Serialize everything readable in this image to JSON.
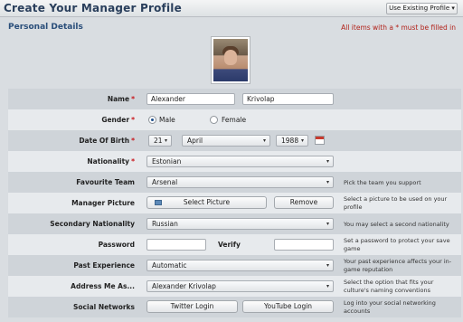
{
  "header": {
    "title": "Create Your Manager Profile",
    "use_existing_label": "Use Existing Profile ▾"
  },
  "section": {
    "title": "Personal Details",
    "required_note": "All items with a * must be filled in"
  },
  "form": {
    "name": {
      "label": "Name",
      "first": "Alexander",
      "last": "Krivolap"
    },
    "gender": {
      "label": "Gender",
      "options": [
        "Male",
        "Female"
      ],
      "selected": "Male"
    },
    "dob": {
      "label": "Date Of Birth",
      "day": "21",
      "month": "April",
      "year": "1988"
    },
    "nationality": {
      "label": "Nationality",
      "value": "Estonian"
    },
    "favourite_team": {
      "label": "Favourite Team",
      "value": "Arsenal",
      "desc": "Pick the team you support"
    },
    "manager_picture": {
      "label": "Manager Picture",
      "select_label": "Select Picture",
      "remove_label": "Remove",
      "desc": "Select a picture to be used on your profile"
    },
    "second_nationality": {
      "label": "Secondary Nationality",
      "value": "Russian",
      "desc": "You may select a second nationality"
    },
    "password": {
      "label": "Password",
      "verify_label": "Verify",
      "desc": "Set a password to protect your save game"
    },
    "past_experience": {
      "label": "Past Experience",
      "value": "Automatic",
      "desc": "Your past experience affects your in-game reputation"
    },
    "address_me": {
      "label": "Address Me As...",
      "value": "Alexander Krivolap",
      "desc": "Select the option that fits your culture's naming conventions"
    },
    "social": {
      "label": "Social Networks",
      "twitter_label": "Twitter Login",
      "youtube_label": "YouTube Login",
      "desc": "Log into your social networking accounts"
    }
  },
  "icons": {
    "caret": "▾",
    "required_marker": "*"
  },
  "colors": {
    "title": "#2a3f5c",
    "section_title": "#2a4e7a",
    "required": "#c8141a"
  }
}
